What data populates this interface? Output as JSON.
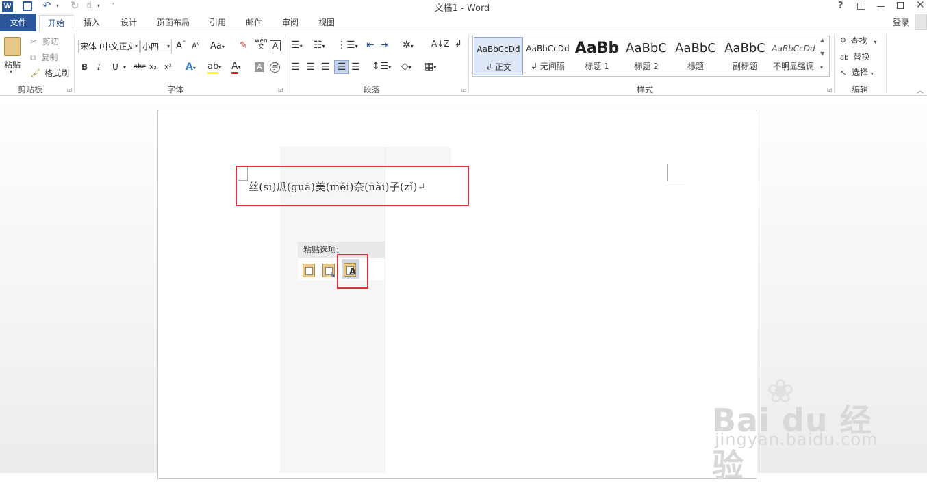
{
  "window": {
    "title": "文档1 - Word",
    "help": "?",
    "login": "登录"
  },
  "tabs": [
    "文件",
    "开始",
    "插入",
    "设计",
    "页面布局",
    "引用",
    "邮件",
    "审阅",
    "视图"
  ],
  "clipboard": {
    "paste": "粘贴",
    "cut": "剪切",
    "copy": "复制",
    "format_painter": "格式刷",
    "label": "剪贴板"
  },
  "font": {
    "name": "宋体 (中文正文)",
    "size": "小四",
    "label": "字体",
    "bold": "B",
    "italic": "I",
    "underline": "U",
    "strike": "abc",
    "sub": "x₂",
    "sup": "x²",
    "change_case": "Aa",
    "phonetic": "wén"
  },
  "paragraph": {
    "label": "段落"
  },
  "styles": {
    "label": "样式",
    "items": [
      {
        "preview": "AaBbCcDd",
        "name": "↲ 正文"
      },
      {
        "preview": "AaBbCcDd",
        "name": "↲ 无间隔"
      },
      {
        "preview": "AaBb",
        "name": "标题 1"
      },
      {
        "preview": "AaBbC",
        "name": "标题 2"
      },
      {
        "preview": "AaBbC",
        "name": "标题"
      },
      {
        "preview": "AaBbC",
        "name": "副标题"
      },
      {
        "preview": "AaBbCcDd",
        "name": "不明显强调"
      }
    ]
  },
  "editing": {
    "label": "编辑",
    "find": "查找",
    "replace": "替换",
    "select": "选择"
  },
  "document": {
    "text": "丝(sī)瓜(guā)美(měi)奈(nài)子(zǐ)↵"
  },
  "paste_options": {
    "title": "粘贴选项:"
  },
  "watermark": {
    "brand": "Bai du 经验",
    "url": "jingyan.baidu.com"
  },
  "colors": {
    "file_tab": "#2b579a",
    "highlight": "#d9303a"
  }
}
